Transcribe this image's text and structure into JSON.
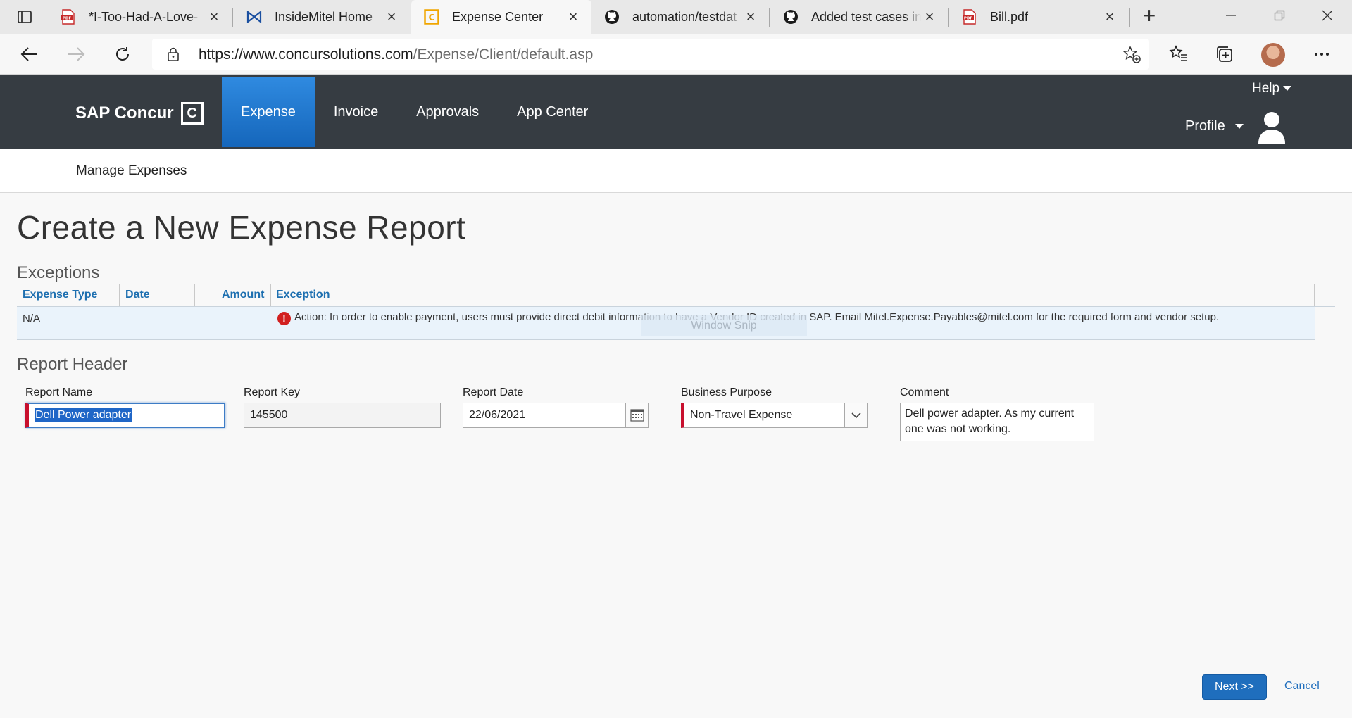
{
  "browser": {
    "tabs": [
      {
        "title": "*I-Too-Had-A-Love-",
        "icon": "pdf-icon",
        "active": false
      },
      {
        "title": "InsideMitel Home",
        "icon": "insidemitel-icon",
        "active": false
      },
      {
        "title": "Expense Center",
        "icon": "concur-icon",
        "active": true
      },
      {
        "title": "automation/testdat",
        "icon": "github-icon",
        "active": false
      },
      {
        "title": "Added test cases in",
        "icon": "github-icon",
        "active": false
      },
      {
        "title": "Bill.pdf",
        "icon": "pdf-icon",
        "active": false
      }
    ],
    "url_prefix": "https://www.concursolutions.com",
    "url_path": "/Expense/Client/default.asp"
  },
  "header": {
    "brand": "SAP Concur",
    "brand_mark": "C",
    "nav": [
      "Expense",
      "Invoice",
      "Approvals",
      "App Center"
    ],
    "active_nav": "Expense",
    "help": "Help",
    "profile": "Profile"
  },
  "subnav": {
    "link": "Manage Expenses"
  },
  "page": {
    "title": "Create a New Expense Report"
  },
  "exceptions": {
    "title": "Exceptions",
    "columns": [
      "Expense Type",
      "Date",
      "Amount",
      "Exception"
    ],
    "rows": [
      {
        "expense_type": "N/A",
        "date": "",
        "amount": "",
        "exception": "Action: In order to enable payment, users must provide direct debit information to have a Vendor ID created in SAP. Email Mitel.Expense.Payables@mitel.com for the required form and vendor setup."
      }
    ],
    "overlay_text": "Window Snip"
  },
  "report_header": {
    "title": "Report Header",
    "report_name_label": "Report Name",
    "report_name_value": "Dell Power adapter",
    "report_key_label": "Report Key",
    "report_key_value": "145500",
    "report_date_label": "Report Date",
    "report_date_value": "22/06/2021",
    "business_purpose_label": "Business Purpose",
    "business_purpose_value": "Non-Travel Expense",
    "comment_label": "Comment",
    "comment_value": "Dell power adapter. As my current one was not working."
  },
  "actions": {
    "next": "Next >>",
    "cancel": "Cancel"
  },
  "colors": {
    "header_bg": "#363c42",
    "nav_active": "#1f76cf",
    "link_blue": "#1f6ebd",
    "required_marker": "#c8102e",
    "exception_row_bg": "#eaf3fb"
  }
}
